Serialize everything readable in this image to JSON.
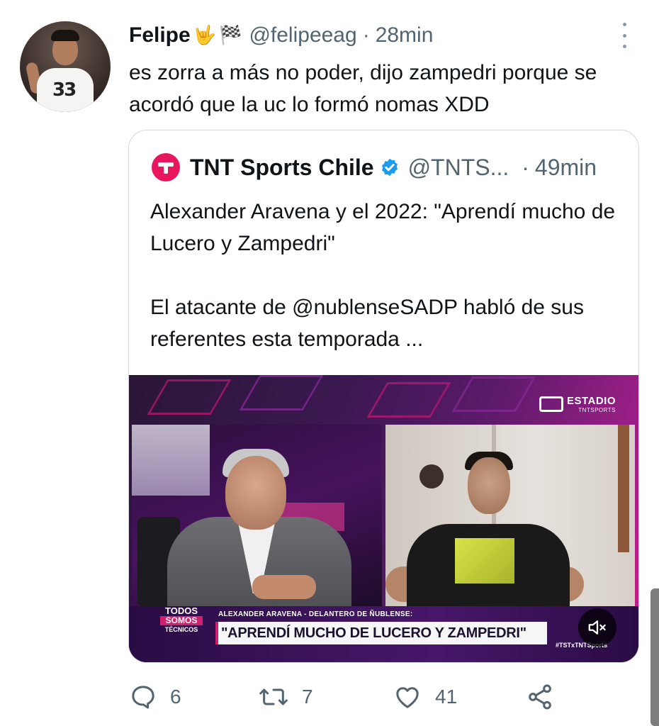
{
  "tweet": {
    "display_name": "Felipe",
    "name_emoji_1": "🤟",
    "name_emoji_2": "🏁",
    "handle": "@felipeeag",
    "separator": "·",
    "time": "28min",
    "text": "es zorra a más no poder, dijo zampedri porque se acordó que la uc lo formó nomas XDD"
  },
  "quoted_tweet": {
    "display_name": "TNT Sports Chile",
    "handle": "@TNTS...",
    "separator": "·",
    "time": "49min",
    "text_line_1": "Alexander Aravena y el 2022: \"Aprendí mucho de Lucero y Zampedri\"",
    "text_line_2": "El atacante de @nublenseSADP habló de sus referentes esta temporada ...",
    "media": {
      "channel_logo": "ESTADIO",
      "channel_sub": "TNTSPORTS",
      "show_logo_1": "TODOS",
      "show_logo_2": "SOMOS",
      "show_logo_3": "TÉCNICOS",
      "caption_small": "ALEXANDER ARAVENA - DELANTERO DE ÑUBLENSE:",
      "caption_main": "\"APRENDÍ MUCHO DE LUCERO Y ZAMPEDRI\"",
      "hashtag": "#TSTxTNTSports"
    }
  },
  "actions": {
    "reply_count": "6",
    "retweet_count": "7",
    "like_count": "41"
  },
  "icons": [
    "more-icon",
    "verified-icon",
    "mute-icon",
    "reply-icon",
    "retweet-icon",
    "like-icon",
    "share-icon"
  ],
  "colors": {
    "text_primary": "#0f1419",
    "text_secondary": "#536471",
    "verified": "#1d9bf0",
    "brand_tnt": "#e8175d"
  }
}
